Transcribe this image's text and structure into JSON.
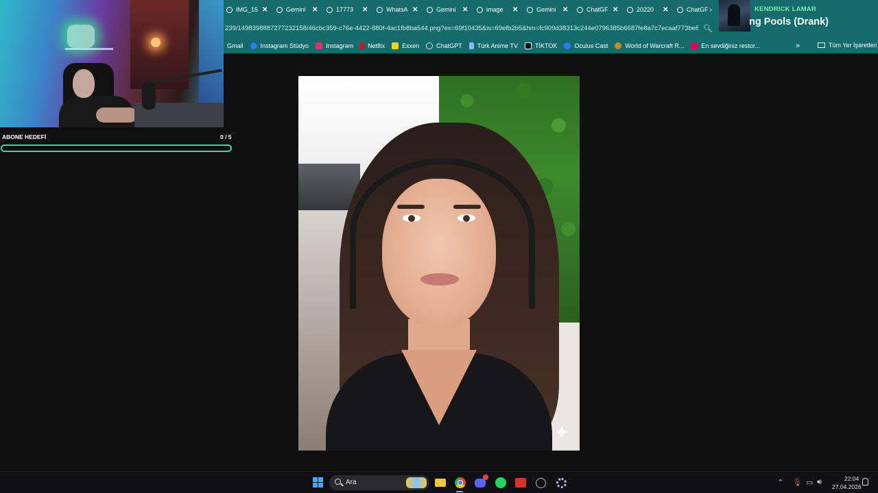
{
  "browser": {
    "tabs": [
      {
        "label": "IMG_15"
      },
      {
        "label": "Gemini"
      },
      {
        "label": "17773"
      },
      {
        "label": "WhatsA"
      },
      {
        "label": "Gemini"
      },
      {
        "label": "image"
      },
      {
        "label": "Gemini"
      },
      {
        "label": "ChatGF"
      },
      {
        "label": "20220"
      },
      {
        "label": "ChatGF"
      }
    ],
    "tab_close_glyph": "✕",
    "url": "239/1498398887277232158/46cbc359-c76e-4422-880f-4ac1fb8ba544.png?ex=69f10435&is=69efb2b5&hm=fc909d38313c244e0796385b6687fe8a7c7ecaaf773be676...",
    "bookmarks": [
      {
        "label": "Gmail",
        "icon": "gmail-icon",
        "color": "#ffffff"
      },
      {
        "label": "Instagram Stüdyo",
        "icon": "meta-icon",
        "color": "#2d7cf6"
      },
      {
        "label": "Instagram",
        "icon": "instagram-icon",
        "color": "#e1306c"
      },
      {
        "label": "Netflix",
        "icon": "netflix-icon",
        "color": "#e50914"
      },
      {
        "label": "Exxen",
        "icon": "exxen-icon",
        "color": "#f5d400"
      },
      {
        "label": "ChatGPT",
        "icon": "chatgpt-icon",
        "color": "#d9d9d9"
      },
      {
        "label": "Türk Anime TV",
        "icon": "anime-icon",
        "color": "#8fb3ff"
      },
      {
        "label": "TİKTOK",
        "icon": "tiktok-icon",
        "color": "#111111"
      },
      {
        "label": "Oculus Cast",
        "icon": "meta-icon",
        "color": "#2d7cf6"
      },
      {
        "label": "World of Warcraft R...",
        "icon": "wow-icon",
        "color": "#c98a2b"
      },
      {
        "label": "En sevdiğiniz restor...",
        "icon": "yemeksepeti-icon",
        "color": "#e2005a"
      }
    ],
    "all_bookmarks_label": "Tüm Yer İşaretleri"
  },
  "now_playing": {
    "artist": "KENDRICK LAMAR",
    "song": "ng Pools (Drank)"
  },
  "stream_overlay": {
    "subscriber_goal_label": "ABONE HEDEFİ",
    "subscriber_goal_count": "0 / 5",
    "subscriber_goal_progress": 0,
    "accent_color": "#3fd9a8"
  },
  "taskbar": {
    "search_placeholder": "Ara",
    "time": "22:04",
    "date": "27.04.2026"
  }
}
